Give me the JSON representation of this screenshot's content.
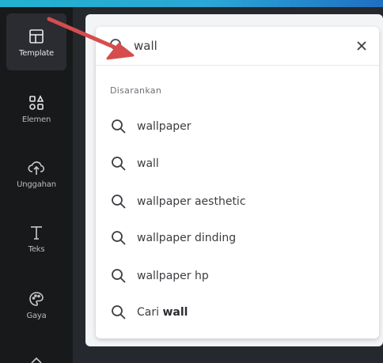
{
  "sidebar": {
    "items": [
      {
        "label": "Template",
        "icon": "template-icon"
      },
      {
        "label": "Elemen",
        "icon": "elements-icon"
      },
      {
        "label": "Unggahan",
        "icon": "upload-icon"
      },
      {
        "label": "Teks",
        "icon": "text-icon"
      },
      {
        "label": "Gaya",
        "icon": "palette-icon"
      }
    ]
  },
  "search": {
    "value": "wall",
    "close_icon": "close-icon"
  },
  "suggestions": {
    "section_label": "Disarankan",
    "items": [
      {
        "text": "wallpaper"
      },
      {
        "text": "wall"
      },
      {
        "text": "wallpaper aesthetic"
      },
      {
        "text": "wallpaper dinding"
      },
      {
        "text": "wallpaper hp"
      }
    ],
    "search_all_prefix": "Cari",
    "search_all_term": "wall"
  },
  "colors": {
    "accent": "#22b2cf",
    "arrow": "#d64d4d",
    "sidebar_bg": "#18191b"
  }
}
